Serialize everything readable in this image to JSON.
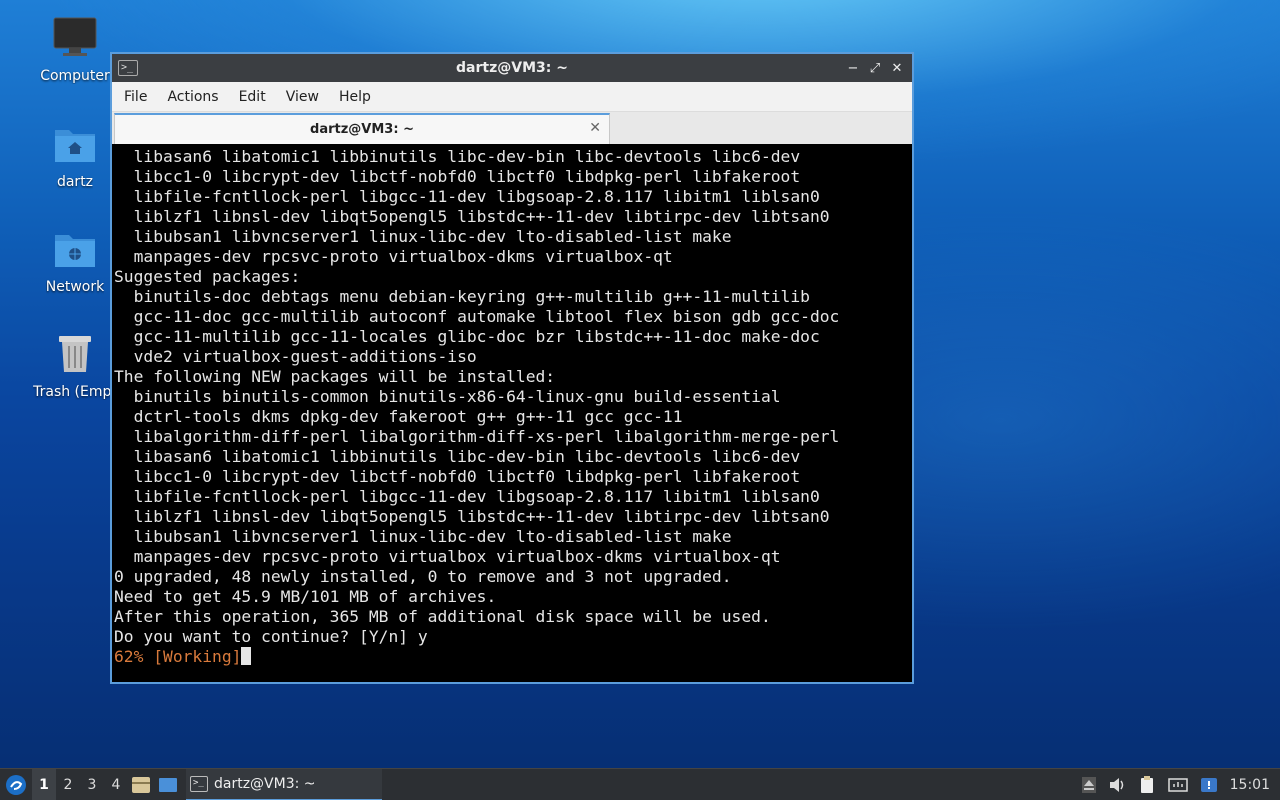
{
  "desktop": {
    "icons": [
      {
        "label": "Computer",
        "icon": "monitor-icon"
      },
      {
        "label": "dartz",
        "icon": "home-folder-icon"
      },
      {
        "label": "Network",
        "icon": "network-folder-icon"
      },
      {
        "label": "Trash (Empt",
        "icon": "trash-icon"
      }
    ]
  },
  "window": {
    "title": "dartz@VM3: ~",
    "controls": {
      "minimize": "−",
      "maximize": "⤢",
      "close": "✕"
    },
    "menu": [
      "File",
      "Actions",
      "Edit",
      "View",
      "Help"
    ],
    "tab": {
      "label": "dartz@VM3: ~",
      "close": "✕"
    }
  },
  "terminal": {
    "lines": [
      "  libasan6 libatomic1 libbinutils libc-dev-bin libc-devtools libc6-dev",
      "  libcc1-0 libcrypt-dev libctf-nobfd0 libctf0 libdpkg-perl libfakeroot",
      "  libfile-fcntllock-perl libgcc-11-dev libgsoap-2.8.117 libitm1 liblsan0",
      "  liblzf1 libnsl-dev libqt5opengl5 libstdc++-11-dev libtirpc-dev libtsan0",
      "  libubsan1 libvncserver1 linux-libc-dev lto-disabled-list make",
      "  manpages-dev rpcsvc-proto virtualbox-dkms virtualbox-qt",
      "Suggested packages:",
      "  binutils-doc debtags menu debian-keyring g++-multilib g++-11-multilib",
      "  gcc-11-doc gcc-multilib autoconf automake libtool flex bison gdb gcc-doc",
      "  gcc-11-multilib gcc-11-locales glibc-doc bzr libstdc++-11-doc make-doc",
      "  vde2 virtualbox-guest-additions-iso",
      "The following NEW packages will be installed:",
      "  binutils binutils-common binutils-x86-64-linux-gnu build-essential",
      "  dctrl-tools dkms dpkg-dev fakeroot g++ g++-11 gcc gcc-11",
      "  libalgorithm-diff-perl libalgorithm-diff-xs-perl libalgorithm-merge-perl",
      "  libasan6 libatomic1 libbinutils libc-dev-bin libc-devtools libc6-dev",
      "  libcc1-0 libcrypt-dev libctf-nobfd0 libctf0 libdpkg-perl libfakeroot",
      "  libfile-fcntllock-perl libgcc-11-dev libgsoap-2.8.117 libitm1 liblsan0",
      "  liblzf1 libnsl-dev libqt5opengl5 libstdc++-11-dev libtirpc-dev libtsan0",
      "  libubsan1 libvncserver1 linux-libc-dev lto-disabled-list make",
      "  manpages-dev rpcsvc-proto virtualbox virtualbox-dkms virtualbox-qt",
      "0 upgraded, 48 newly installed, 0 to remove and 3 not upgraded.",
      "Need to get 45.9 MB/101 MB of archives.",
      "After this operation, 365 MB of additional disk space will be used.",
      "Do you want to continue? [Y/n] y"
    ],
    "progress_line": "62% [Working]",
    "progress_color": "#d97a3c"
  },
  "taskbar": {
    "workspaces": [
      "1",
      "2",
      "3",
      "4"
    ],
    "active_workspace": "1",
    "task_label": "dartz@VM3: ~",
    "clock": "15:01"
  },
  "colors": {
    "accent": "#5b9ddc",
    "terminal_bg": "#000000",
    "terminal_fg": "#e6e6e6"
  }
}
